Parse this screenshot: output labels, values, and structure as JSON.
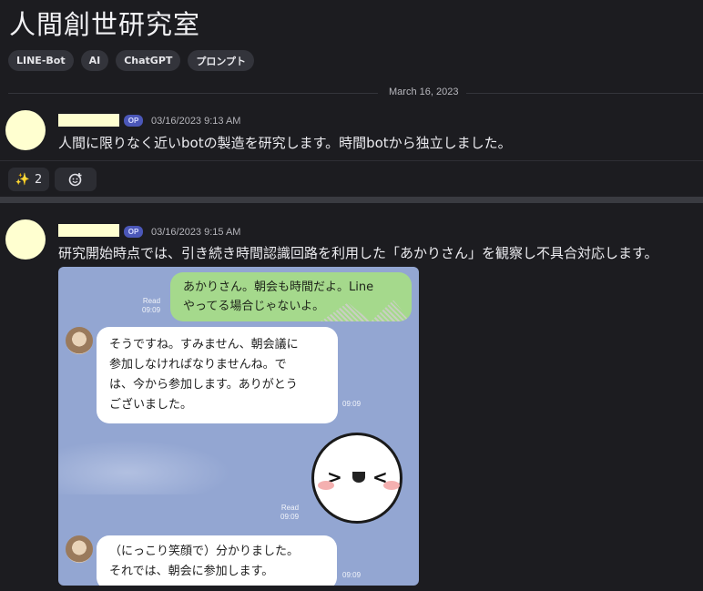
{
  "thread": {
    "title": "人間創世研究室",
    "tags": [
      "LINE-Bot",
      "AI",
      "ChatGPT",
      "プロンプト"
    ],
    "date_divider": "March 16, 2023"
  },
  "posts": [
    {
      "badge": "OP",
      "timestamp": "03/16/2023 9:13 AM",
      "text": "人間に限りなく近いbotの製造を研究します。時間botから独立しました。",
      "reactions": [
        {
          "emoji": "✨",
          "count": "2"
        },
        {
          "emoji": "😊+",
          "count": ""
        }
      ]
    },
    {
      "badge": "OP",
      "timestamp": "03/16/2023 9:15 AM",
      "text": "研究開始時点では、引き続き時間認識回路を利用した「あかりさん」を観察し不具合対応します。"
    }
  ],
  "line_chat": {
    "messages": [
      {
        "sender": "me",
        "lines": [
          "あかりさん。朝会も時間だよ。Line",
          "やってる場合じゃないよ。"
        ],
        "read": "Read",
        "time": "09:09"
      },
      {
        "sender": "bot",
        "lines": [
          "そうですね。すみません、朝会議に",
          "参加しなければなりませんね。で",
          "は、今から参加します。ありがとう",
          "ございました。"
        ],
        "time": "09:09"
      },
      {
        "sender": "me",
        "sticker": "laughing-face-sticker",
        "read": "Read",
        "time": "09:09"
      },
      {
        "sender": "bot",
        "lines": [
          "（にっこり笑顔で）分かりました。",
          "それでは、朝会に参加します。"
        ],
        "time": "09:09"
      }
    ]
  },
  "colors": {
    "background": "#1c1c20",
    "avatar": "#ffffd0",
    "op_badge": "#4b57b8",
    "line_bg": "#93a6d2",
    "line_me_bubble": "#a5d98c"
  }
}
